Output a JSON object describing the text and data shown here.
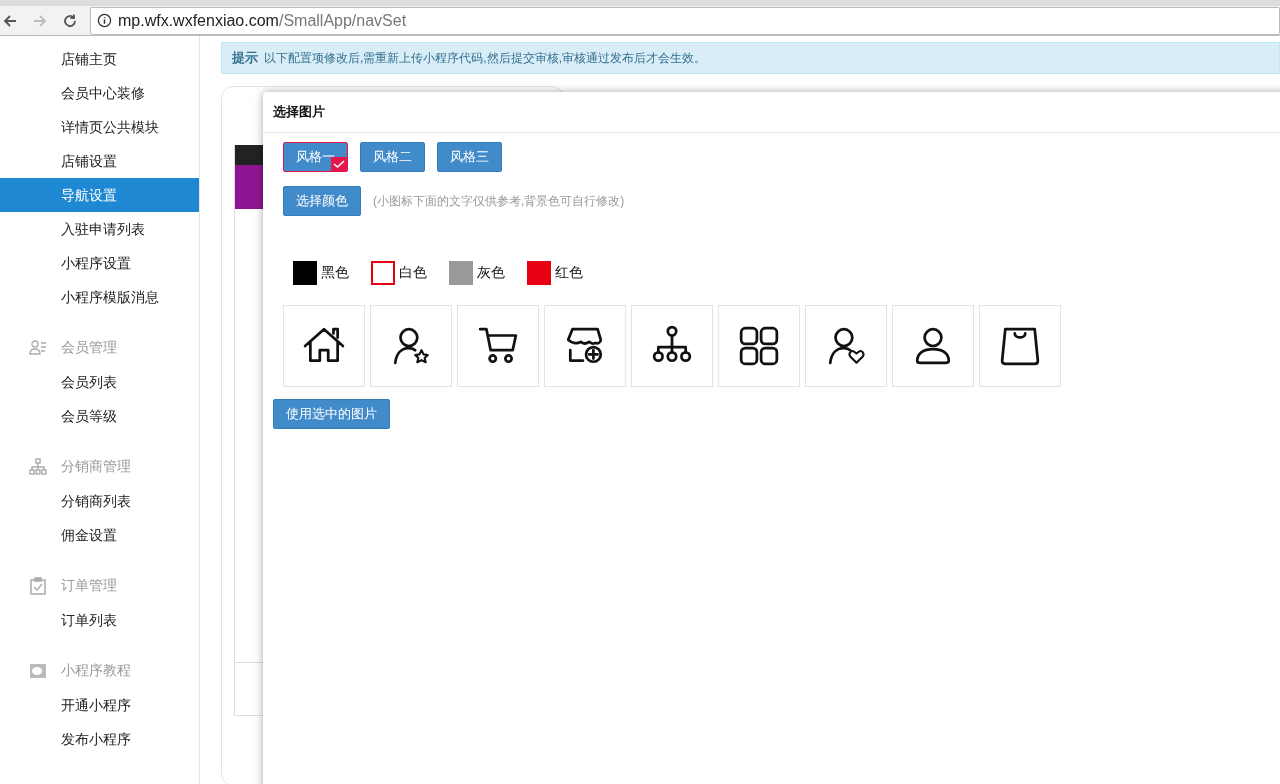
{
  "browser": {
    "url_host": "mp.wfx.wxfenxiao.com",
    "url_path": "/SmallApp/navSet"
  },
  "sidebar": {
    "groups": [
      {
        "items": [
          {
            "label": "店铺主页",
            "selected": false
          },
          {
            "label": "会员中心装修",
            "selected": false
          },
          {
            "label": "详情页公共模块",
            "selected": false
          },
          {
            "label": "店铺设置",
            "selected": false
          },
          {
            "label": "导航设置",
            "selected": true
          },
          {
            "label": "入驻申请列表",
            "selected": false
          },
          {
            "label": "小程序设置",
            "selected": false
          },
          {
            "label": "小程序模版消息",
            "selected": false
          }
        ]
      },
      {
        "title": "会员管理",
        "kind": "members",
        "items": [
          {
            "label": "会员列表",
            "selected": false
          },
          {
            "label": "会员等级",
            "selected": false
          }
        ]
      },
      {
        "title": "分销商管理",
        "kind": "distributors",
        "items": [
          {
            "label": "分销商列表",
            "selected": false
          },
          {
            "label": "佣金设置",
            "selected": false
          }
        ]
      },
      {
        "title": "订单管理",
        "kind": "orders",
        "items": [
          {
            "label": "订单列表",
            "selected": false
          }
        ]
      },
      {
        "title": "小程序教程",
        "kind": "tutorial",
        "items": [
          {
            "label": "开通小程序",
            "selected": false
          },
          {
            "label": "发布小程序",
            "selected": false
          }
        ]
      }
    ]
  },
  "notice": {
    "label": "提示",
    "text": "以下配置项修改后,需重新上传小程序代码,然后提交审核,审核通过发布后才会生效。"
  },
  "modal": {
    "title": "选择图片",
    "styles": [
      {
        "label": "风格一",
        "selected": true
      },
      {
        "label": "风格二",
        "selected": false
      },
      {
        "label": "风格三",
        "selected": false
      }
    ],
    "color_button": "选择颜色",
    "hint": "(小图标下面的文字仅供参考,背景色可自行修改)",
    "colors": [
      {
        "label": "黑色",
        "color": "#000000",
        "outlined": false
      },
      {
        "label": "白色",
        "color": "#ffffff",
        "outlined": true
      },
      {
        "label": "灰色",
        "color": "#999999",
        "outlined": false
      },
      {
        "label": "红色",
        "color": "#e60012",
        "outlined": false
      }
    ],
    "use_button": "使用选中的图片"
  }
}
